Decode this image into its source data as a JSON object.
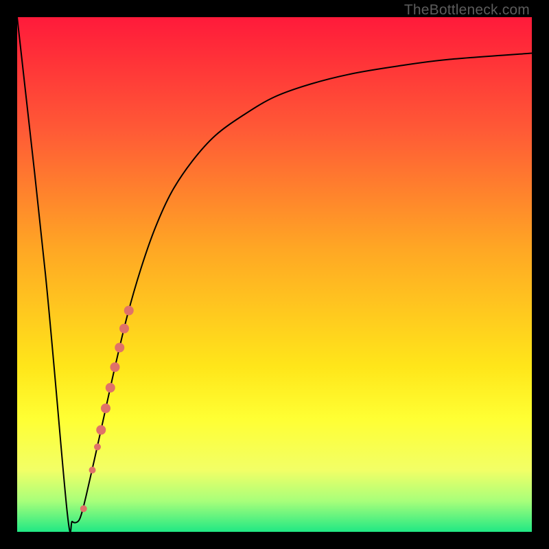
{
  "attribution": "TheBottleneck.com",
  "chart_data": {
    "type": "line",
    "title": "",
    "xlabel": "",
    "ylabel": "",
    "xlim": [
      0,
      100
    ],
    "ylim": [
      0,
      100
    ],
    "grid": false,
    "background_gradient": {
      "direction": "vertical",
      "stops": [
        {
          "pos": 0.0,
          "color": "#ff1a3a"
        },
        {
          "pos": 0.22,
          "color": "#ff5a36"
        },
        {
          "pos": 0.45,
          "color": "#ffa724"
        },
        {
          "pos": 0.68,
          "color": "#ffe61a"
        },
        {
          "pos": 0.78,
          "color": "#ffff33"
        },
        {
          "pos": 0.88,
          "color": "#f2ff66"
        },
        {
          "pos": 0.94,
          "color": "#a8ff7a"
        },
        {
          "pos": 1.0,
          "color": "#20e884"
        }
      ]
    },
    "series": [
      {
        "name": "bottleneck-curve",
        "color": "#000000",
        "stroke_width": 2,
        "x": [
          0,
          5.5,
          9.7,
          10.7,
          11.8,
          12.5,
          13.4,
          15.0,
          17.0,
          19.0,
          21.4,
          24.0,
          26.8,
          30.0,
          34.0,
          38.5,
          44.0,
          50.0,
          57.0,
          65.0,
          74.0,
          84.0,
          100.0
        ],
        "y": [
          100,
          50,
          4,
          2,
          2,
          3.5,
          7,
          14,
          23,
          32,
          42,
          51,
          59,
          66,
          72,
          77,
          81,
          84.5,
          87,
          89,
          90.5,
          91.8,
          93
        ]
      }
    ],
    "highlight_markers": {
      "name": "highlight-segment",
      "color": "#e07268",
      "points": [
        {
          "x": 12.9,
          "y": 4.5,
          "r": 5
        },
        {
          "x": 14.6,
          "y": 12.0,
          "r": 5
        },
        {
          "x": 15.6,
          "y": 16.5,
          "r": 5
        },
        {
          "x": 16.3,
          "y": 19.8,
          "r": 7
        },
        {
          "x": 17.2,
          "y": 24.0,
          "r": 7
        },
        {
          "x": 18.1,
          "y": 28.0,
          "r": 7
        },
        {
          "x": 19.0,
          "y": 32.0,
          "r": 7
        },
        {
          "x": 19.9,
          "y": 35.8,
          "r": 7
        },
        {
          "x": 20.8,
          "y": 39.5,
          "r": 7
        },
        {
          "x": 21.7,
          "y": 43.0,
          "r": 7
        }
      ]
    }
  }
}
